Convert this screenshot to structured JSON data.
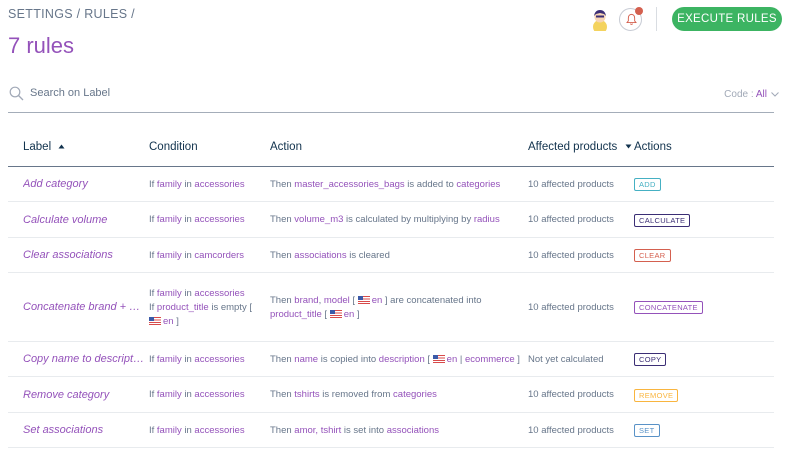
{
  "breadcrumb": "SETTINGS / RULES /",
  "title": "7 rules",
  "header": {
    "execute_label": "EXECUTE RULES"
  },
  "search": {
    "placeholder": "Search on Label"
  },
  "code_filter": {
    "label": "Code",
    "value": "All"
  },
  "columns": {
    "label": "Label",
    "condition": "Condition",
    "action": "Action",
    "affected": "Affected products",
    "actions": "Actions"
  },
  "rows": [
    {
      "label": "Add category",
      "condition": [
        [
          "If ",
          [
            "family",
            "h"
          ],
          " in ",
          [
            "accessories",
            "h"
          ]
        ]
      ],
      "action": [
        [
          "Then ",
          [
            "master_accessories_bags",
            "h"
          ],
          " is added to ",
          [
            "categories",
            "h"
          ]
        ]
      ],
      "affected": "10 affected products",
      "badge": "ADD"
    },
    {
      "label": "Calculate volume",
      "condition": [
        [
          "If ",
          [
            "family",
            "h"
          ],
          " in ",
          [
            "accessories",
            "h"
          ]
        ]
      ],
      "action": [
        [
          "Then ",
          [
            "volume_m3",
            "h"
          ],
          " is calculated by multiplying by ",
          [
            "radius",
            "h"
          ]
        ]
      ],
      "affected": "10 affected products",
      "badge": "CALCULATE"
    },
    {
      "label": "Clear associations",
      "condition": [
        [
          "If ",
          [
            "family",
            "h"
          ],
          " in ",
          [
            "camcorders",
            "h"
          ]
        ]
      ],
      "action": [
        [
          "Then ",
          [
            "associations",
            "h"
          ],
          " is cleared"
        ]
      ],
      "affected": "10 affected products",
      "badge": "CLEAR"
    },
    {
      "label": "Concatenate brand + m…",
      "condition": [
        [
          "If ",
          [
            "family",
            "h"
          ],
          " in ",
          [
            "accessories",
            "h"
          ]
        ],
        [
          "If ",
          [
            "product_title",
            "h"
          ],
          " is empty ["
        ],
        [
          [
            "flag",
            "f"
          ],
          [
            "en",
            "h"
          ],
          " ]"
        ]
      ],
      "action": [
        [
          "Then ",
          [
            "brand",
            "h"
          ],
          ", ",
          [
            "model",
            "h"
          ],
          " [ ",
          [
            "flag",
            "f"
          ],
          [
            "en",
            "h"
          ],
          " ] are concatenated into"
        ],
        [
          [
            "product_title",
            "h"
          ],
          " [ ",
          [
            "flag",
            "f"
          ],
          [
            "en",
            "h"
          ],
          " ]"
        ]
      ],
      "affected": "10 affected products",
      "badge": "CONCATENATE"
    },
    {
      "label": "Copy name to description",
      "condition": [
        [
          "If ",
          [
            "family",
            "h"
          ],
          " in ",
          [
            "accessories",
            "h"
          ]
        ]
      ],
      "action": [
        [
          "Then ",
          [
            "name",
            "h"
          ],
          " is copied into ",
          [
            "description",
            "h"
          ],
          " [ ",
          [
            "flag",
            "f"
          ],
          [
            "en",
            "h"
          ],
          " | ",
          [
            "ecommerce",
            "h"
          ],
          " ]"
        ]
      ],
      "affected": "Not yet calculated",
      "badge": "COPY"
    },
    {
      "label": "Remove category",
      "condition": [
        [
          "If ",
          [
            "family",
            "h"
          ],
          " in ",
          [
            "accessories",
            "h"
          ]
        ]
      ],
      "action": [
        [
          "Then ",
          [
            "tshirts",
            "h"
          ],
          " is removed from ",
          [
            "categories",
            "h"
          ]
        ]
      ],
      "affected": "10 affected products",
      "badge": "REMOVE"
    },
    {
      "label": "Set associations",
      "condition": [
        [
          "If ",
          [
            "family",
            "h"
          ],
          " in ",
          [
            "accessories",
            "h"
          ]
        ]
      ],
      "action": [
        [
          "Then ",
          [
            "amor, tshirt",
            "h"
          ],
          " is set into ",
          [
            "associations",
            "h"
          ]
        ]
      ],
      "affected": "10 affected products",
      "badge": "SET"
    }
  ],
  "badge_colors": {
    "ADD": "#45b0c3",
    "CALCULATE": "#3b2e75",
    "CLEAR": "#d4604f",
    "CONCATENATE": "#9452ba",
    "COPY": "#3b2e75",
    "REMOVE": "#f9b53f",
    "SET": "#5992c7"
  },
  "icons": {
    "search": "search-icon",
    "bell": "bell-icon",
    "avatar": "user-avatar",
    "sort_up": "sort-ascending-icon",
    "sort_down": "sort-descending-icon",
    "chevron": "chevron-down-icon",
    "flag": "flag-us-icon"
  }
}
